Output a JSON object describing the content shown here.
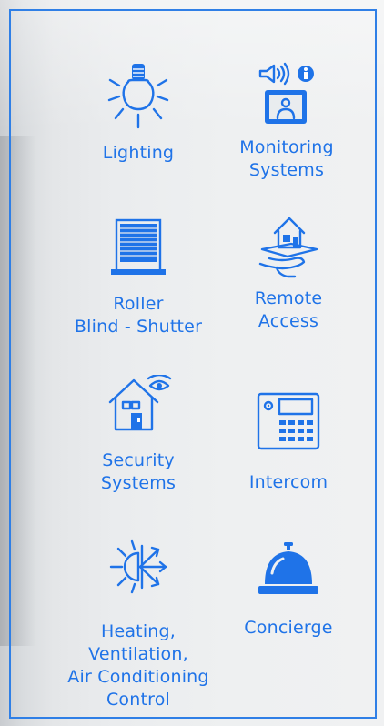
{
  "accent_color": "#1f73e8",
  "features": {
    "lighting": {
      "label": "Lighting",
      "icon": "lightbulb-icon"
    },
    "monitoring": {
      "label": "Monitoring\nSystems",
      "icon": "monitoring-icon"
    },
    "roller": {
      "label": "Roller\nBlind - Shutter",
      "icon": "roller-blind-icon"
    },
    "remote": {
      "label": "Remote\nAccess",
      "icon": "remote-access-icon"
    },
    "security": {
      "label": "Security\nSystems",
      "icon": "security-house-icon"
    },
    "intercom": {
      "label": "Intercom",
      "icon": "intercom-keypad-icon"
    },
    "hvac": {
      "label": "Heating,\nVentilation,\nAir Conditioning\nControl",
      "icon": "hvac-icon"
    },
    "concierge": {
      "label": "Concierge",
      "icon": "concierge-bell-icon"
    }
  }
}
